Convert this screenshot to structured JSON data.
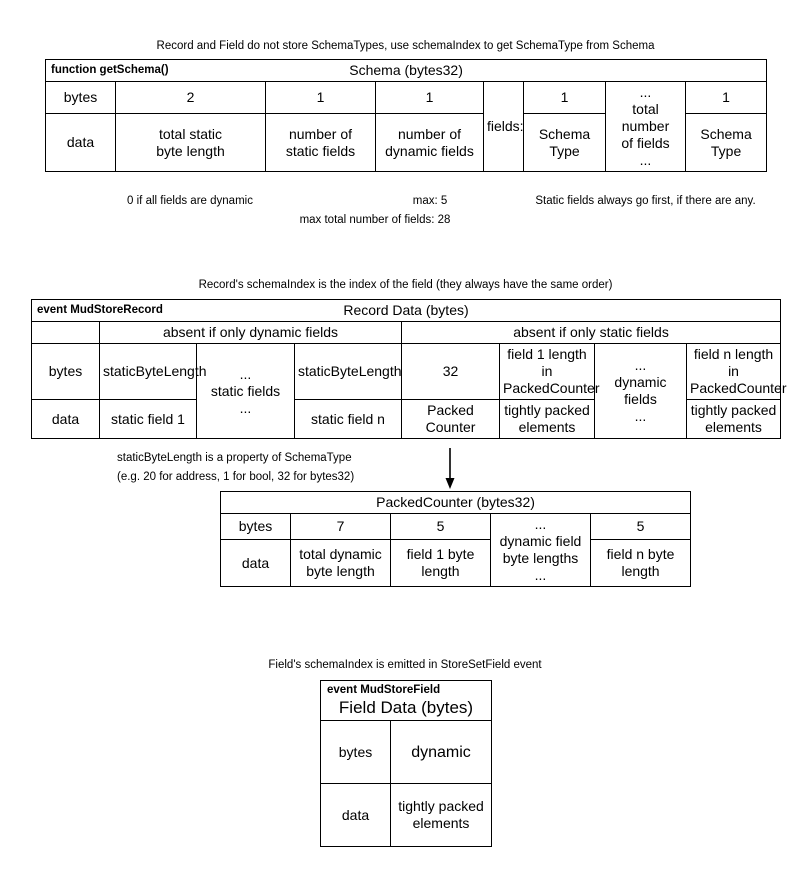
{
  "notes": {
    "schema_top": "Record and Field do not store SchemaTypes, use schemaIndex to get SchemaType from Schema",
    "schema_note_dynamic": "0 if all fields are dynamic",
    "schema_note_max5": "max: 5",
    "schema_note_maxtotal": "max total number of fields: 28",
    "schema_note_staticfirst": "Static fields always go first, if there are any.",
    "record_top": "Record's schemaIndex is the index of the field (they always have the same order)",
    "record_note_sbl_1": "staticByteLength is a property of SchemaType",
    "record_note_sbl_2": "(e.g. 20 for address, 1 for bool, 32 for bytes32)",
    "field_top": "Field's schemaIndex is emitted in StoreSetField event"
  },
  "schema_table": {
    "tag": "function getSchema()",
    "title": "Schema (bytes32)",
    "row_label_bytes": "bytes",
    "row_label_data": "data",
    "fields_label": "fields:",
    "bytes_row": [
      "2",
      "1",
      "1",
      "1",
      "1"
    ],
    "data_row": [
      "total static\nbyte length",
      "number of\nstatic fields",
      "number of\ndynamic fields",
      "Schema\nType",
      "Schema\nType"
    ],
    "ellipsis_cell": "...\ntotal number\nof fields\n..."
  },
  "record_table": {
    "tag": "event MudStoreRecord",
    "title": "Record Data (bytes)",
    "absent_dynamic": "absent if only dynamic fields",
    "absent_static": "absent if only static fields",
    "row_label_bytes": "bytes",
    "row_label_data": "data",
    "bytes_static_1": "staticByteLength",
    "bytes_static_n": "staticByteLength",
    "bytes_packed": "32",
    "bytes_field1": "field 1 length in\nPackedCounter",
    "bytes_fieldn": "field n length in\nPackedCounter",
    "data_static_1": "static field 1",
    "data_static_n": "static field n",
    "data_packed": "Packed\nCounter",
    "data_field1": "tightly packed\nelements",
    "data_fieldn": "tightly packed\nelements",
    "ellipsis_static": "...\nstatic fields\n...",
    "ellipsis_dynamic": "...\ndynamic fields\n..."
  },
  "packed_counter_table": {
    "title": "PackedCounter (bytes32)",
    "row_label_bytes": "bytes",
    "row_label_data": "data",
    "bytes_total": "7",
    "bytes_field1": "5",
    "bytes_fieldn": "5",
    "data_total": "total dynamic\nbyte length",
    "data_field1": "field 1 byte\nlength",
    "data_fieldn": "field n byte\nlength",
    "ellipsis_cell": "...\ndynamic field\nbyte lengths\n..."
  },
  "field_table": {
    "tag": "event MudStoreField",
    "title": "Field Data (bytes)",
    "row_label_bytes": "bytes",
    "row_label_data": "data",
    "bytes_dynamic": "dynamic",
    "data_packed": "tightly packed\nelements"
  }
}
